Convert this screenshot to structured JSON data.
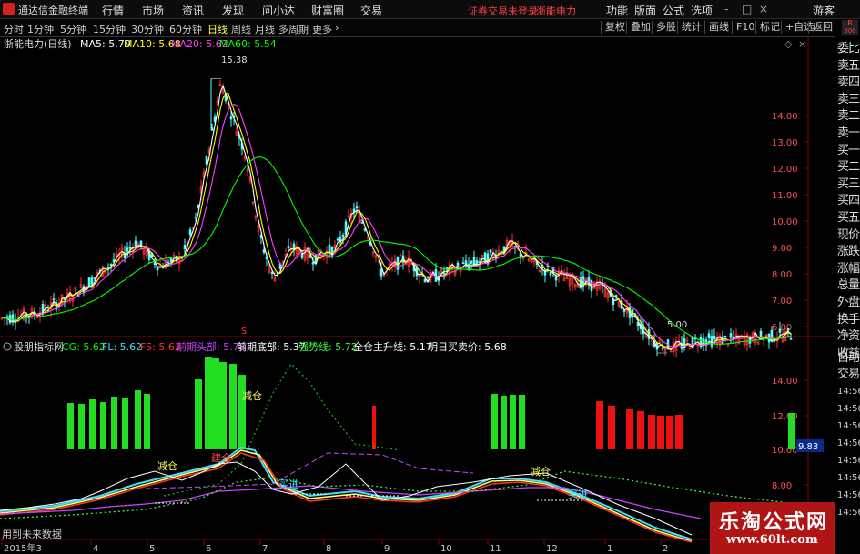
{
  "app": {
    "title": "通达信金融终端",
    "menu": [
      "行情",
      "市场",
      "资讯",
      "发现",
      "问小达",
      "财富圈",
      "交易"
    ],
    "notice_login": "证券交易未登录",
    "notice_stock": "浙能电力",
    "right_menu": [
      "功能",
      "版面",
      "公式",
      "选项"
    ],
    "window_controls": [
      "-",
      "□",
      "×"
    ],
    "guest": "游客"
  },
  "toolbar": {
    "periods": [
      "分时",
      "1分钟",
      "5分钟",
      "15分钟",
      "30分钟",
      "60分钟",
      "日线",
      "周线",
      "月线",
      "多周期",
      "更多"
    ],
    "active_period": "日线",
    "right_buttons": [
      "复权",
      "叠加",
      "多股",
      "统计",
      "画线",
      "F10",
      "标记",
      "+自选",
      "返回"
    ],
    "r_badge": "R",
    "r_value": "300"
  },
  "main_chart": {
    "title": "浙能电力(日线)",
    "ma": [
      {
        "label": "MA5: 5.70",
        "color": "#ffffff"
      },
      {
        "label": "MA10: 5.68",
        "color": "#ffff00"
      },
      {
        "label": "MA20: 5.62",
        "color": "#ff40ff"
      },
      {
        "label": "MA60: 5.54",
        "color": "#00ff00"
      }
    ],
    "high_label": "15.38",
    "low_label": "5.00",
    "y_ticks": [
      "14.00",
      "13.00",
      "12.00",
      "11.00",
      "10.00",
      "9.00",
      "8.00",
      "7.00",
      "6.00"
    ]
  },
  "indicator": {
    "name": "股朋指标网",
    "items": [
      {
        "label": "CG: 5.62",
        "color": "#00ff00"
      },
      {
        "label": "FL: 5.62",
        "color": "#40e0ff"
      },
      {
        "label": "FS: 5.62",
        "color": "#ff3030"
      },
      {
        "label": "前期头部: 5.78",
        "color": "#cc44ff"
      },
      {
        "label": "前期底部: 5.37",
        "color": "#ffffff"
      },
      {
        "label": "强势线: 5.72",
        "color": "#40ff40"
      },
      {
        "label": "全仓主升线: 5.17",
        "color": "#ffffff"
      },
      {
        "label": "明日买卖价: 5.68",
        "color": "#ffffff"
      }
    ],
    "y_ticks": [
      "14.00",
      "12.00",
      "10.00",
      "8.00"
    ],
    "current_value": "9.83",
    "annotations": [
      "减仓",
      "减仓",
      "建仓",
      "减仓",
      "买进",
      "买进"
    ],
    "future_data_note": "用到未来数据",
    "marker_s": "S"
  },
  "x_axis": [
    "2015年3",
    "4",
    "5",
    "6",
    "7",
    "8",
    "9",
    "10",
    "11",
    "12",
    "1",
    "2"
  ],
  "side_panel": {
    "items": [
      "委比",
      "卖五",
      "卖四",
      "卖三",
      "卖二",
      "卖一",
      "买一",
      "买二",
      "买三",
      "买四",
      "买五",
      "现价",
      "涨跌",
      "涨幅",
      "总量",
      "外盘",
      "换手",
      "净资",
      "收益"
    ],
    "bottom_items": [
      "自动",
      "交易"
    ],
    "times": [
      "14:56",
      "14:56",
      "14:56",
      "14:56",
      "14:56",
      "14:56",
      "14:56",
      "14:56"
    ]
  },
  "watermark": {
    "title": "乐淘公式网",
    "url": "www.60lt.com"
  },
  "colors": {
    "up": "#ff3030",
    "down": "#54ffff",
    "ma5": "#ffffff",
    "ma10": "#ffff00",
    "ma20": "#ff40ff",
    "ma60": "#00ff00",
    "bar_green": "#22dd22",
    "bar_red": "#ee1111"
  }
}
